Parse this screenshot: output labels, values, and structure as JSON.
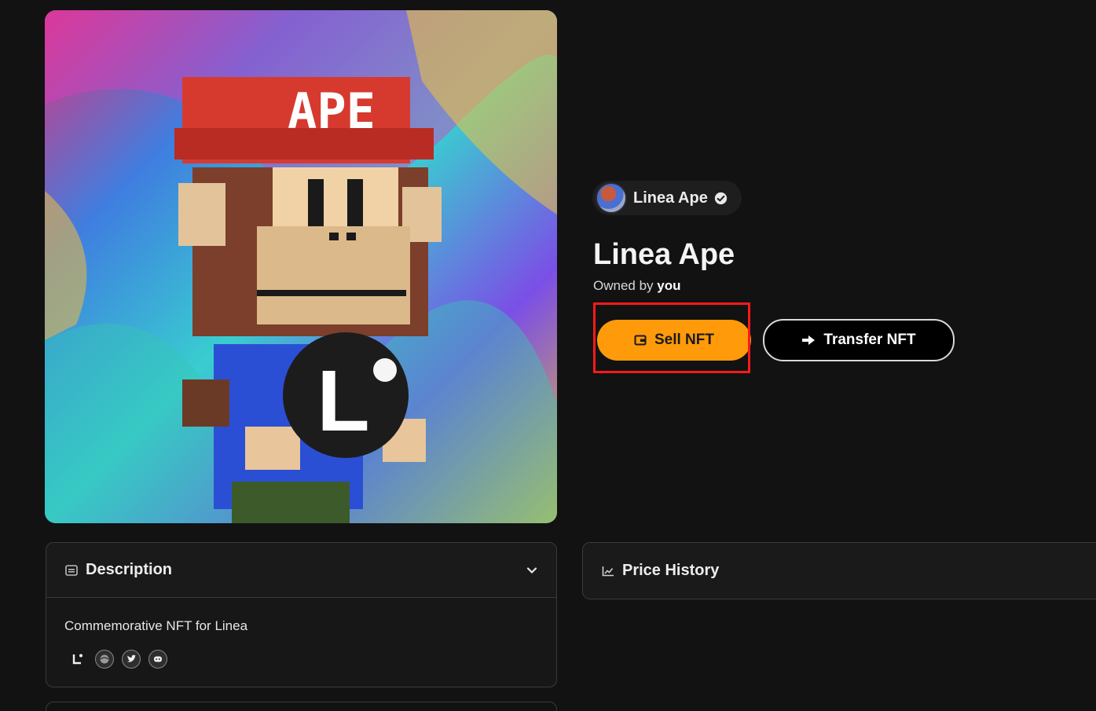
{
  "collection": {
    "name": "Linea Ape",
    "avatar_icon": "ape-avatar-icon",
    "verified_icon": "verified-check-icon"
  },
  "nft": {
    "title": "Linea Ape",
    "owned_by_prefix": "Owned by",
    "owner": "you",
    "art_cap_text": "APE",
    "art_badge_letter": "L"
  },
  "actions": {
    "sell_label": "Sell NFT",
    "sell_icon": "wallet-icon",
    "transfer_label": "Transfer NFT",
    "transfer_icon": "arrow-right-icon"
  },
  "description_panel": {
    "title": "Description",
    "icon": "description-icon",
    "text": "Commemorative NFT for Linea",
    "links": [
      "linea-icon",
      "website-icon",
      "twitter-icon",
      "discord-icon"
    ]
  },
  "price_history_panel": {
    "title": "Price History",
    "icon": "chart-icon"
  },
  "colors": {
    "background": "#121212",
    "sell_button": "#ff9a0b",
    "highlight": "#ff1a1a"
  }
}
